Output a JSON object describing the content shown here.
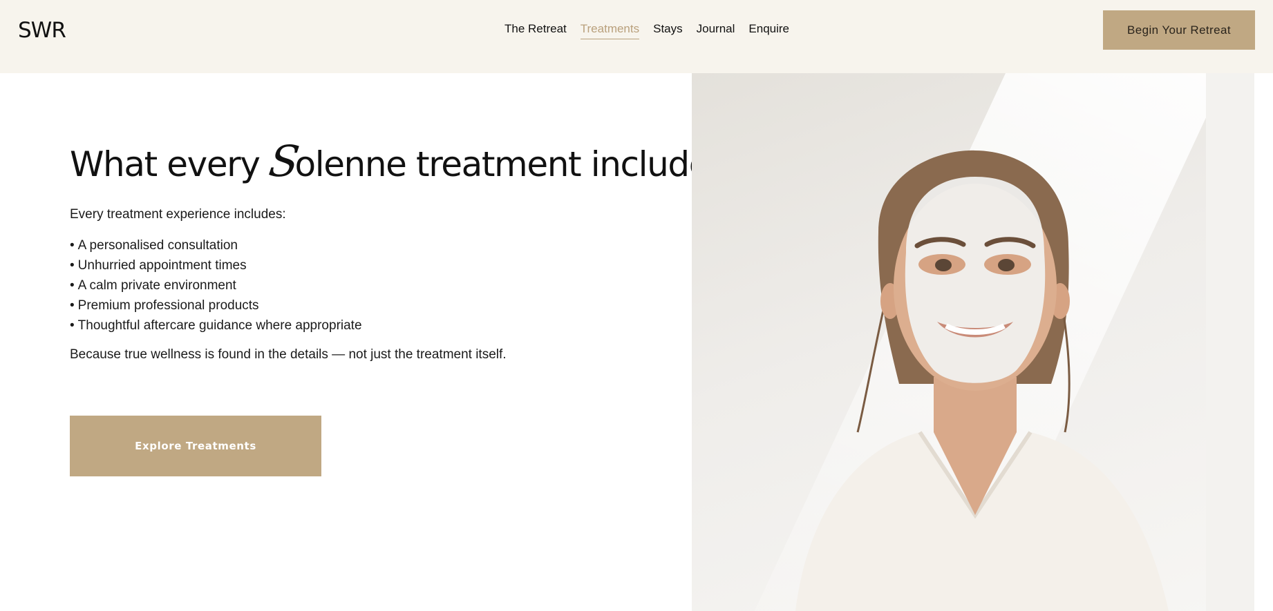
{
  "header": {
    "logo": "SWR",
    "nav": [
      {
        "label": "The Retreat",
        "active": false
      },
      {
        "label": "Treatments",
        "active": true
      },
      {
        "label": "Stays",
        "active": false
      },
      {
        "label": "Journal",
        "active": false
      },
      {
        "label": "Enquire",
        "active": false
      }
    ],
    "cta_label": "Begin Your Retreat"
  },
  "main": {
    "headline_before": "What every ",
    "headline_script": "S",
    "headline_after": "olenne treatment includes",
    "intro": "Every treatment experience includes:",
    "bullet": "•",
    "items": [
      "A personalised consultation",
      "Unhurried appointment times",
      "A calm private environment",
      "Premium professional products",
      "Thoughtful aftercare guidance where appropriate"
    ],
    "outro": "Because true wellness is found in the details — not just the treatment itself.",
    "cta_label": "Explore Treatments"
  },
  "colors": {
    "header_bg": "#f7f4ed",
    "accent": "#c0a883",
    "nav_active": "#b9a07c"
  }
}
